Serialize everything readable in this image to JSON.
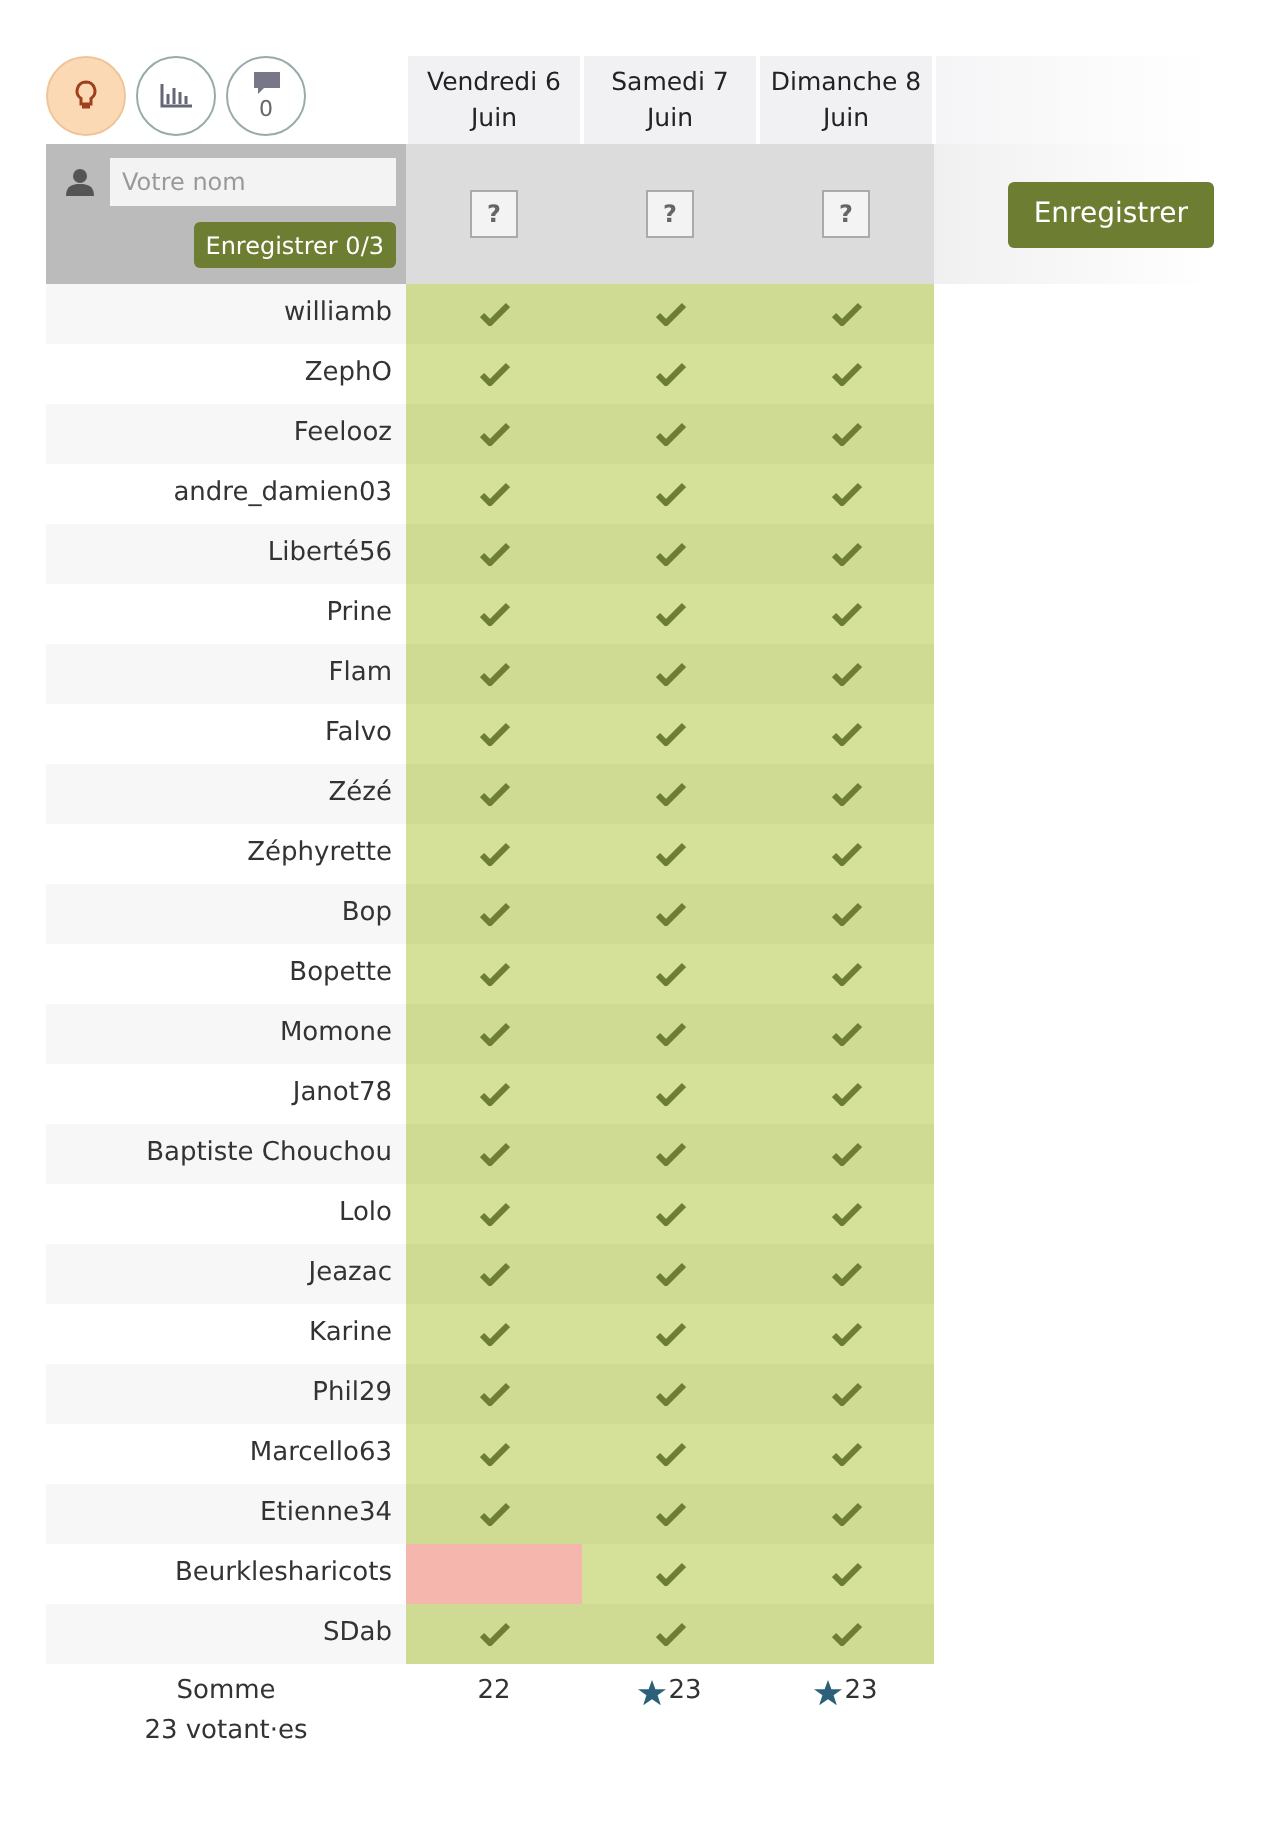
{
  "toolbar": [
    {
      "kind": "bulb",
      "selected": true
    },
    {
      "kind": "chart",
      "selected": false
    },
    {
      "kind": "comment",
      "selected": false,
      "count": "0"
    }
  ],
  "dates": [
    {
      "day": "Vendredi 6",
      "month": "Juin",
      "choice": "?"
    },
    {
      "day": "Samedi 7",
      "month": "Juin",
      "choice": "?"
    },
    {
      "day": "Dimanche 8",
      "month": "Juin",
      "choice": "?"
    }
  ],
  "name_field": {
    "placeholder": "Votre nom"
  },
  "small_save": "Enregistrer 0/3",
  "save": "Enregistrer",
  "rows": [
    {
      "name": "williamb",
      "votes": [
        {
          "yes": true
        },
        {
          "yes": true
        },
        {
          "yes": true
        }
      ]
    },
    {
      "name": "ZephO",
      "votes": [
        {
          "yes": true
        },
        {
          "yes": true
        },
        {
          "yes": true
        }
      ]
    },
    {
      "name": "Feelooz",
      "votes": [
        {
          "yes": true
        },
        {
          "yes": true
        },
        {
          "yes": true
        }
      ]
    },
    {
      "name": "andre_damien03",
      "votes": [
        {
          "yes": true
        },
        {
          "yes": true
        },
        {
          "yes": true
        }
      ]
    },
    {
      "name": "Liberté56",
      "votes": [
        {
          "yes": true
        },
        {
          "yes": true
        },
        {
          "yes": true
        }
      ]
    },
    {
      "name": "Prine",
      "votes": [
        {
          "yes": true
        },
        {
          "yes": true
        },
        {
          "yes": true
        }
      ]
    },
    {
      "name": "Flam",
      "votes": [
        {
          "yes": true
        },
        {
          "yes": true
        },
        {
          "yes": true
        }
      ]
    },
    {
      "name": "Falvo",
      "votes": [
        {
          "yes": true
        },
        {
          "yes": true
        },
        {
          "yes": true
        }
      ]
    },
    {
      "name": "Zézé",
      "votes": [
        {
          "yes": true
        },
        {
          "yes": true
        },
        {
          "yes": true
        }
      ]
    },
    {
      "name": "Zéphyrette",
      "votes": [
        {
          "yes": true
        },
        {
          "yes": true
        },
        {
          "yes": true
        }
      ]
    },
    {
      "name": "Bop",
      "votes": [
        {
          "yes": true
        },
        {
          "yes": true
        },
        {
          "yes": true
        }
      ]
    },
    {
      "name": "Bopette",
      "votes": [
        {
          "yes": true
        },
        {
          "yes": true
        },
        {
          "yes": true
        }
      ]
    },
    {
      "name": "Momone",
      "votes": [
        {
          "yes": true
        },
        {
          "yes": true
        },
        {
          "yes": true
        }
      ]
    },
    {
      "name": "Janot78",
      "votes": [
        {
          "yes": true
        },
        {
          "yes": true
        },
        {
          "yes": true
        }
      ]
    },
    {
      "name": "Baptiste Chouchou",
      "votes": [
        {
          "yes": true
        },
        {
          "yes": true
        },
        {
          "yes": true
        }
      ]
    },
    {
      "name": "Lolo",
      "votes": [
        {
          "yes": true
        },
        {
          "yes": true
        },
        {
          "yes": true
        }
      ]
    },
    {
      "name": "Jeazac",
      "votes": [
        {
          "yes": true
        },
        {
          "yes": true
        },
        {
          "yes": true
        }
      ]
    },
    {
      "name": "Karine",
      "votes": [
        {
          "yes": true
        },
        {
          "yes": true
        },
        {
          "yes": true
        }
      ]
    },
    {
      "name": "Phil29",
      "votes": [
        {
          "yes": true
        },
        {
          "yes": true
        },
        {
          "yes": true
        }
      ]
    },
    {
      "name": "Marcello63",
      "votes": [
        {
          "yes": true
        },
        {
          "yes": true
        },
        {
          "yes": true
        }
      ]
    },
    {
      "name": "Etienne34",
      "votes": [
        {
          "yes": true
        },
        {
          "yes": true
        },
        {
          "yes": true
        }
      ]
    },
    {
      "name": "Beurklesharicots",
      "votes": [
        {
          "yes": false
        },
        {
          "yes": true
        },
        {
          "yes": true
        }
      ]
    },
    {
      "name": "SDab",
      "votes": [
        {
          "yes": true
        },
        {
          "yes": true
        },
        {
          "yes": true
        }
      ]
    }
  ],
  "totals": {
    "label": "Somme",
    "voters": "23 votant·es",
    "values": [
      {
        "value": "22",
        "best": false
      },
      {
        "value": "23",
        "best": true
      },
      {
        "value": "23",
        "best": true
      }
    ]
  }
}
